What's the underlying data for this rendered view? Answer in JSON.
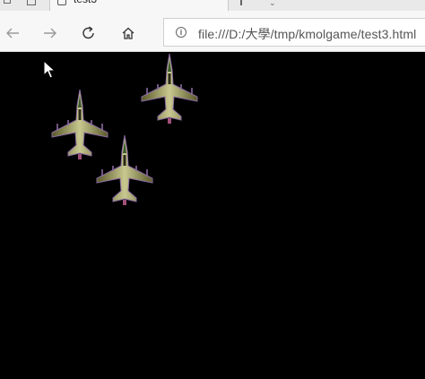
{
  "browser": {
    "tab": {
      "title": "test3",
      "icon": "page-icon"
    },
    "toolbar": {
      "back_icon": "back-arrow-icon",
      "forward_icon": "forward-arrow-icon",
      "refresh_icon": "refresh-icon",
      "home_icon": "home-icon"
    },
    "address": {
      "info_icon": "info-icon",
      "url": "file:///D:/大學/tmp/kmolgame/test3.html"
    }
  },
  "page": {
    "background": "#000000",
    "sprites": [
      {
        "name": "fighter-jet-icon"
      },
      {
        "name": "fighter-jet-icon"
      },
      {
        "name": "fighter-jet-icon"
      }
    ]
  },
  "cursor": {
    "icon": "mouse-pointer-icon"
  }
}
